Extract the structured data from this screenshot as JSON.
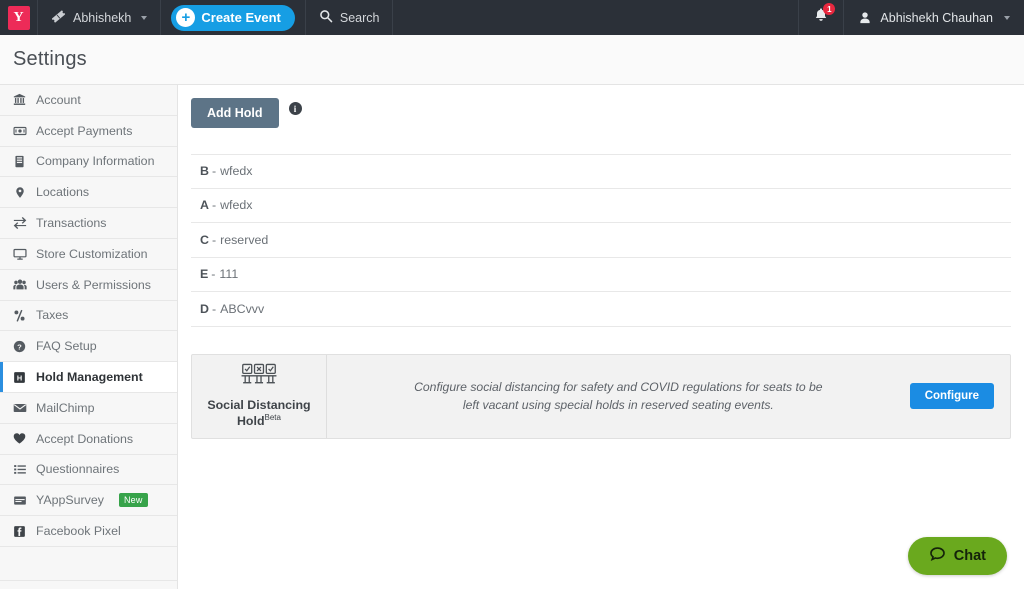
{
  "topnav": {
    "logo_text": "Y",
    "logo_color": "#ed2b58",
    "org_label": "Abhishekh",
    "create_event_label": "Create Event",
    "search_label": "Search",
    "notification_count": "1",
    "user_name": "Abhishekh Chauhan",
    "accent_color": "#169ee4",
    "bg_color": "#2b3038"
  },
  "header": {
    "title": "Settings"
  },
  "sidebar": {
    "items": [
      {
        "label": "Account",
        "icon": "bank-icon",
        "active": false
      },
      {
        "label": "Accept Payments",
        "icon": "money-icon",
        "active": false
      },
      {
        "label": "Company Information",
        "icon": "building-icon",
        "active": false
      },
      {
        "label": "Locations",
        "icon": "map-pin-icon",
        "active": false
      },
      {
        "label": "Transactions",
        "icon": "exchange-icon",
        "active": false
      },
      {
        "label": "Store Customization",
        "icon": "monitor-icon",
        "active": false
      },
      {
        "label": "Users & Permissions",
        "icon": "users-icon",
        "active": false
      },
      {
        "label": "Taxes",
        "icon": "percent-icon",
        "active": false
      },
      {
        "label": "FAQ Setup",
        "icon": "question-circle-icon",
        "active": false
      },
      {
        "label": "Hold Management",
        "icon": "hold-box-icon",
        "active": true
      },
      {
        "label": "MailChimp",
        "icon": "envelope-icon",
        "active": false
      },
      {
        "label": "Accept Donations",
        "icon": "heart-icon",
        "active": false
      },
      {
        "label": "Questionnaires",
        "icon": "list-icon",
        "active": false
      },
      {
        "label": "YAppSurvey",
        "icon": "survey-window-icon",
        "active": false,
        "badge": "New"
      },
      {
        "label": "Facebook Pixel",
        "icon": "facebook-icon",
        "active": false
      }
    ],
    "badge_color": "#37a34a",
    "active_marker_color": "#2b8fe0"
  },
  "main": {
    "add_hold_label": "Add Hold",
    "add_hold_color": "#5d7487",
    "info_tooltip_icon": "info-icon",
    "holds": [
      {
        "key": "B",
        "value": "wfedx"
      },
      {
        "key": "A",
        "value": "wfedx"
      },
      {
        "key": "C",
        "value": "reserved"
      },
      {
        "key": "E",
        "value": "111"
      },
      {
        "key": "D",
        "value": "ABCvvv"
      }
    ],
    "separator": "-"
  },
  "social_distancing_card": {
    "title_line1": "Social Distancing",
    "title_line2": "Hold",
    "beta_label": "Beta",
    "description": "Configure social distancing for safety and COVID regulations for seats to be left vacant using special holds in reserved seating events.",
    "configure_label": "Configure",
    "configure_color": "#1b8ce3",
    "icon": "three-seats-icon"
  },
  "chat": {
    "label": "Chat",
    "color": "#6aa91e",
    "icon": "speech-bubble-icon"
  }
}
